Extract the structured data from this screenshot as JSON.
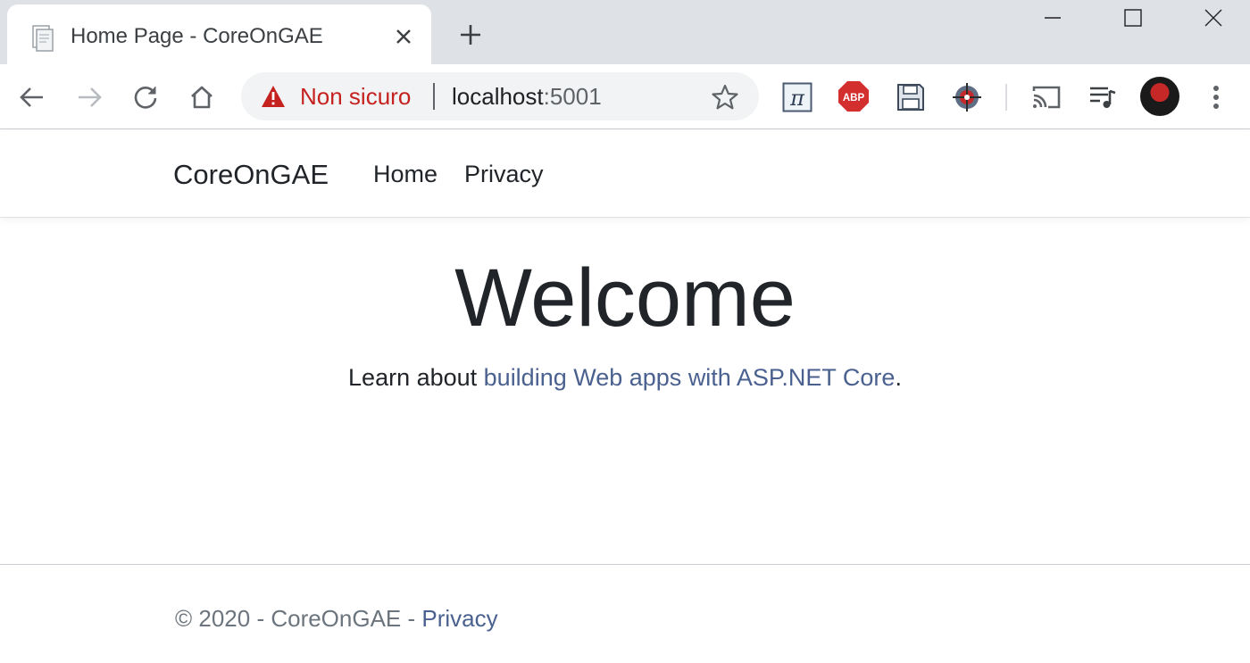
{
  "browser": {
    "tab": {
      "title": "Home Page - CoreOnGAE",
      "favicon_icon": "document-icon",
      "close_icon": "close-icon"
    },
    "new_tab_icon": "plus-icon",
    "window_controls": [
      "minimize-icon",
      "maximize-icon",
      "close-icon"
    ],
    "toolbar": {
      "back_icon": "arrow-left-icon",
      "forward_icon": "arrow-right-icon",
      "reload_icon": "reload-icon",
      "home_icon": "home-icon",
      "extensions": [
        "pi-icon",
        "adblock-icon",
        "save-icon",
        "target-icon"
      ],
      "cast_icon": "cast-icon",
      "media_icon": "media-queue-icon",
      "profile_icon": "avatar",
      "menu_icon": "kebab-menu-icon"
    },
    "omnibox": {
      "security_text": "Non sicuro",
      "security_icon": "warning-icon",
      "url_host": "localhost",
      "url_port": ":5001",
      "bookmark_icon": "star-icon",
      "security_color": "#c5221f"
    },
    "extension_labels": {
      "adblock": "ABP"
    }
  },
  "page": {
    "navbar": {
      "brand": "CoreOnGAE",
      "links": [
        "Home",
        "Privacy"
      ]
    },
    "main": {
      "heading": "Welcome",
      "lead_text": "Learn about ",
      "lead_link": "building Web apps with ASP.NET Core",
      "lead_end": "."
    },
    "footer": {
      "prefix": "© 2020 - CoreOnGAE - ",
      "privacy_link": "Privacy"
    },
    "link_color": "#4a6190"
  }
}
